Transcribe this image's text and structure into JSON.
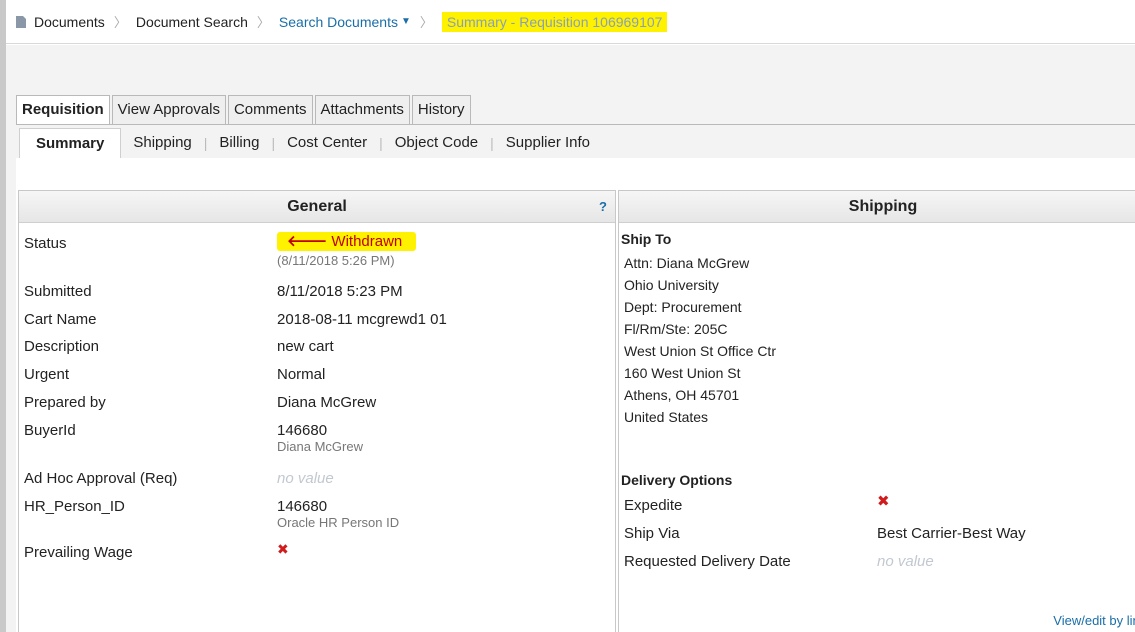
{
  "breadcrumb": {
    "items": [
      "Documents",
      "Document Search",
      "Search Documents",
      "Summary - Requisition 106969107"
    ]
  },
  "tabs_primary": [
    "Requisition",
    "View Approvals",
    "Comments",
    "Attachments",
    "History"
  ],
  "tabs_secondary": [
    "Summary",
    "Shipping",
    "Billing",
    "Cost Center",
    "Object Code",
    "Supplier Info"
  ],
  "general": {
    "title": "General",
    "help": "?",
    "status_label": "Status",
    "status_value": "Withdrawn",
    "status_date": "(8/11/2018 5:26 PM)",
    "submitted_label": "Submitted",
    "submitted_value": "8/11/2018 5:23 PM",
    "cart_label": "Cart Name",
    "cart_value": "2018-08-11 mcgrewd1 01",
    "desc_label": "Description",
    "desc_value": "new cart",
    "urgent_label": "Urgent",
    "urgent_value": "Normal",
    "prepared_label": "Prepared by",
    "prepared_value": "Diana McGrew",
    "buyer_label": "BuyerId",
    "buyer_value": "146680",
    "buyer_sub": "Diana McGrew",
    "adhoc_label": "Ad Hoc Approval (Req)",
    "adhoc_value": "no value",
    "hr_label": "HR_Person_ID",
    "hr_value": "146680",
    "hr_sub": "Oracle HR Person ID",
    "wage_label": "Prevailing Wage",
    "wage_value": "✖"
  },
  "shipping": {
    "title": "Shipping",
    "ship_to_title": "Ship To",
    "ship_to_lines": [
      "Attn: Diana McGrew",
      "Ohio University",
      "Dept: Procurement",
      "Fl/Rm/Ste: 205C",
      "West Union St Office Ctr",
      "160 West Union St",
      "Athens, OH 45701",
      "United States"
    ],
    "delivery_title": "Delivery Options",
    "expedite_label": "Expedite",
    "expedite_value": "✖",
    "shipvia_label": "Ship Via",
    "shipvia_value": "Best Carrier-Best Way",
    "reqdate_label": "Requested Delivery Date",
    "reqdate_value": "no value",
    "view_link": "View/edit by line"
  },
  "colors": {
    "highlight": "#fff200",
    "link": "#1a6ea8",
    "withdrawn": "#c00000"
  }
}
